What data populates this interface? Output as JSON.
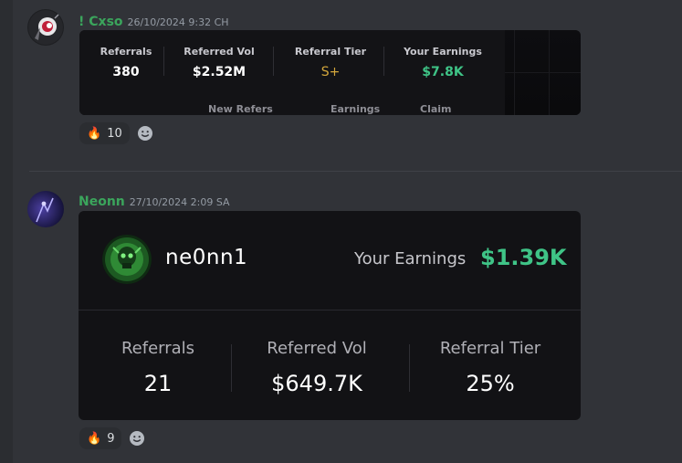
{
  "messages": [
    {
      "author": "! Cxso",
      "author_color": "#3ba55c",
      "timestamp": "26/10/2024 9:32 CH",
      "embed": {
        "stats": [
          {
            "label": "Referrals",
            "value": "380"
          },
          {
            "label": "Referred Vol",
            "value": "$2.52M"
          },
          {
            "label": "Referral Tier",
            "value": "S+"
          },
          {
            "label": "Your Earnings",
            "value": "$7.8K"
          }
        ],
        "tabs": [
          "New Refers",
          "Earnings",
          "Claim"
        ]
      },
      "reaction": {
        "emoji": "🔥",
        "count": "10"
      }
    },
    {
      "author": "Neonn",
      "author_color": "#3ba55c",
      "timestamp": "27/10/2024 2:09 SA",
      "embed": {
        "username": "ne0nn1",
        "earnings_label": "Your Earnings",
        "earnings_value": "$1.39K",
        "stats": [
          {
            "label": "Referrals",
            "value": "21"
          },
          {
            "label": "Referred Vol",
            "value": "$649.7K"
          },
          {
            "label": "Referral Tier",
            "value": "25%"
          }
        ]
      },
      "reaction": {
        "emoji": "🔥",
        "count": "9"
      }
    }
  ],
  "colors": {
    "background": "#313338",
    "embed_bg": "#121215",
    "earnings_green": "#3fc487",
    "tier_gold": "#d4a73c"
  },
  "icons": {
    "add_reaction": "smile-icon"
  }
}
